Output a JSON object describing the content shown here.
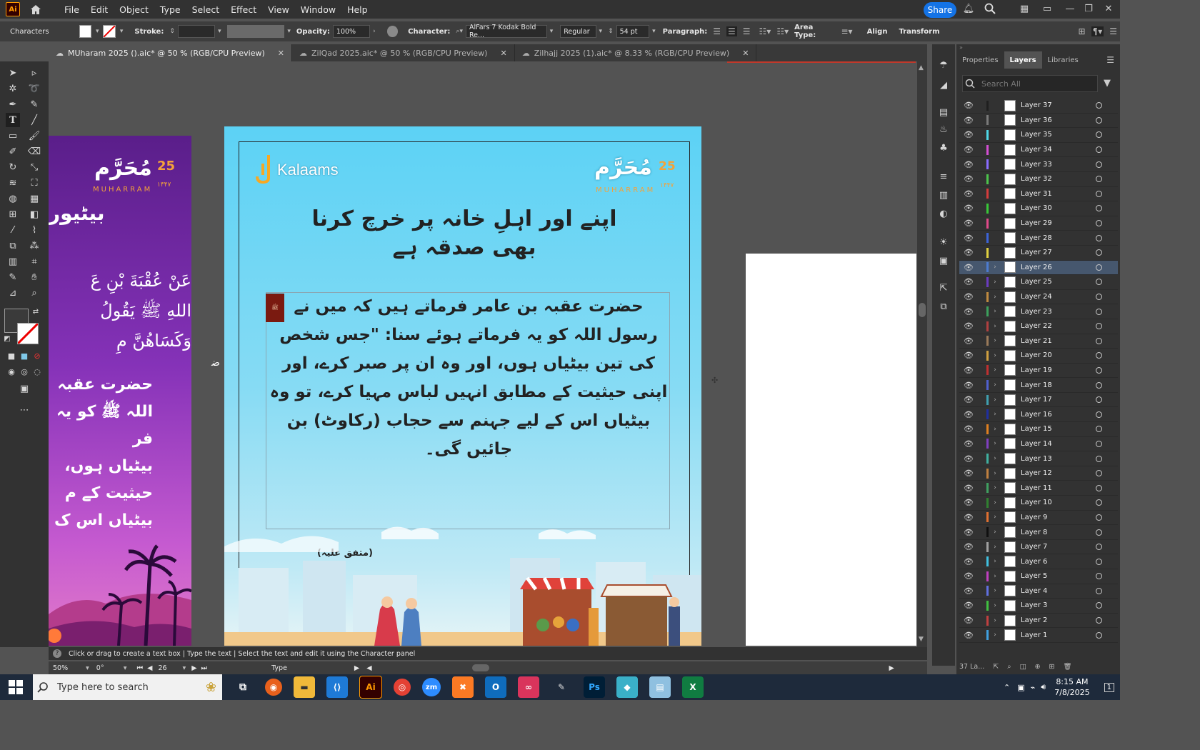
{
  "menubar": {
    "app_icon": "Ai",
    "items": [
      "File",
      "Edit",
      "Object",
      "Type",
      "Select",
      "Effect",
      "View",
      "Window",
      "Help"
    ],
    "share_label": "Share"
  },
  "controlbar": {
    "panel_label": "Characters",
    "stroke_label": "Stroke:",
    "opacity_label": "Opacity:",
    "opacity_value": "100%",
    "character_label": "Character:",
    "font_family": "AlFars 7 Kodak Bold Re...",
    "font_style": "Regular",
    "font_size": "54 pt",
    "paragraph_label": "Paragraph:",
    "area_type_label": "Area Type:",
    "align_label": "Align",
    "transform_label": "Transform"
  },
  "tabs": [
    {
      "label": "MUharam 2025 ().aic* @ 50 % (RGB/CPU Preview)",
      "active": true
    },
    {
      "label": "ZilQad 2025.aic* @ 50 % (RGB/CPU Preview)",
      "active": false
    },
    {
      "label": "Zilhajj 2025 (1).aic* @ 8.33 % (RGB/CPU Preview)",
      "active": false
    }
  ],
  "artboard_main": {
    "brand": "Kalaams",
    "badge_number": "25",
    "badge_word": "MUHARRAM",
    "badge_year": "۱۴۴۷",
    "title": "اپنے اور اہلِ خانہ پر خرچ کرنا بھی صدقہ ہے",
    "body": "حضرت عقبہ بن عامر فرماتے ہیں کہ میں نے رسول اللہ کو یہ فرماتے ہوئے سنا: \"جس شخص کی تین بیٹیاں ہوں، اور وہ ان پر صبر کرے، اور اپنی حیثیت کے مطابق انہیں لباس مہیا کرے، تو وہ بیٹیاں اس کے لیے جہنم سے حجاب (رکاوٹ) بن جائیں گی۔",
    "reference": "(متفق علیہ)"
  },
  "artboard_left": {
    "badge_number": "25",
    "badge_word": "MUHARRAM",
    "badge_year": "۱۴۴۷",
    "heading": "بیٹیور",
    "arabic_lines": [
      "عَنْ عُقْبَةَ بْنِ عَ",
      "اللهِ ﷺ يَقُولُ",
      "وَكَسَاهُنَّ مِ"
    ],
    "urdu_lines": [
      "حضرت عقبہ",
      "اللہ ﷺ کو یہ فر",
      "بیٹیاں ہوں،",
      "حیثیت کے م",
      "بیٹیاں اس ک"
    ]
  },
  "panel": {
    "tabs": [
      "Properties",
      "Layers",
      "Libraries"
    ],
    "active_tab": "Layers",
    "search_placeholder": "Search All",
    "layers": [
      {
        "name": "Layer 37",
        "color": "#1f1f1f",
        "expand": false
      },
      {
        "name": "Layer 36",
        "color": "#7a7a7a",
        "expand": false
      },
      {
        "name": "Layer 35",
        "color": "#4fd8e8",
        "expand": false
      },
      {
        "name": "Layer 34",
        "color": "#d34fd3",
        "expand": false
      },
      {
        "name": "Layer 33",
        "color": "#8a6cff",
        "expand": false
      },
      {
        "name": "Layer 32",
        "color": "#4cc44c",
        "expand": false
      },
      {
        "name": "Layer 31",
        "color": "#d43c3c",
        "expand": false
      },
      {
        "name": "Layer 30",
        "color": "#38c838",
        "expand": false
      },
      {
        "name": "Layer 29",
        "color": "#e04a8a",
        "expand": false
      },
      {
        "name": "Layer 28",
        "color": "#3c64d8",
        "expand": false
      },
      {
        "name": "Layer 27",
        "color": "#e0d040",
        "expand": false
      },
      {
        "name": "Layer 26",
        "color": "#4c7cd0",
        "expand": true,
        "selected": true
      },
      {
        "name": "Layer 25",
        "color": "#6a3cc0",
        "expand": true
      },
      {
        "name": "Layer 24",
        "color": "#c08a40",
        "expand": true
      },
      {
        "name": "Layer 23",
        "color": "#3ca05c",
        "expand": true
      },
      {
        "name": "Layer 22",
        "color": "#b04040",
        "expand": true
      },
      {
        "name": "Layer 21",
        "color": "#9a7a5a",
        "expand": true
      },
      {
        "name": "Layer 20",
        "color": "#d0a040",
        "expand": true
      },
      {
        "name": "Layer 19",
        "color": "#c03030",
        "expand": true
      },
      {
        "name": "Layer 18",
        "color": "#5060d0",
        "expand": true
      },
      {
        "name": "Layer 17",
        "color": "#40a0b0",
        "expand": true
      },
      {
        "name": "Layer 16",
        "color": "#1f2fa0",
        "expand": true
      },
      {
        "name": "Layer 15",
        "color": "#e08020",
        "expand": true
      },
      {
        "name": "Layer 14",
        "color": "#8040c0",
        "expand": true
      },
      {
        "name": "Layer 13",
        "color": "#40b0a0",
        "expand": true
      },
      {
        "name": "Layer 12",
        "color": "#c08040",
        "expand": true
      },
      {
        "name": "Layer 11",
        "color": "#40a060",
        "expand": true
      },
      {
        "name": "Layer 10",
        "color": "#308030",
        "expand": true
      },
      {
        "name": "Layer 9",
        "color": "#e07030",
        "expand": true
      },
      {
        "name": "Layer 8",
        "color": "#101010",
        "expand": true
      },
      {
        "name": "Layer 7",
        "color": "#a0a0a0",
        "expand": true
      },
      {
        "name": "Layer 6",
        "color": "#40c0e0",
        "expand": true
      },
      {
        "name": "Layer 5",
        "color": "#c040c0",
        "expand": true
      },
      {
        "name": "Layer 4",
        "color": "#6070e0",
        "expand": true
      },
      {
        "name": "Layer 3",
        "color": "#40c040",
        "expand": true
      },
      {
        "name": "Layer 2",
        "color": "#c04040",
        "expand": true
      },
      {
        "name": "Layer 1",
        "color": "#40a0e0",
        "expand": true
      }
    ],
    "footer_count": "37 La..."
  },
  "statusbar": {
    "hint": "Click or drag to create a text box  |  Type the text  |  Select the text and edit it using the Character panel",
    "zoom": "50%",
    "rotation": "0°",
    "artboard_number": "26",
    "tool": "Type"
  },
  "taskbar": {
    "search_placeholder": "Type here to search",
    "time": "8:15 AM",
    "date": "7/8/2025",
    "notifications": "1",
    "apps": [
      "firefox-icon",
      "file-explorer-icon",
      "vscode-icon",
      "illustrator-icon",
      "chrome-icon",
      "zoom-icon",
      "xampp-icon",
      "outlook-icon",
      "creative-cloud-icon",
      "pen-icon",
      "photoshop-icon",
      "app-icon",
      "notepad-icon",
      "excel-icon"
    ]
  },
  "colors": {
    "accent": "#1473e6",
    "app_orange": "#ff9a00",
    "layer_selected": "#46576e",
    "artboard_sky": "#5cd2f5",
    "artboard_purple": "#8532b8"
  }
}
